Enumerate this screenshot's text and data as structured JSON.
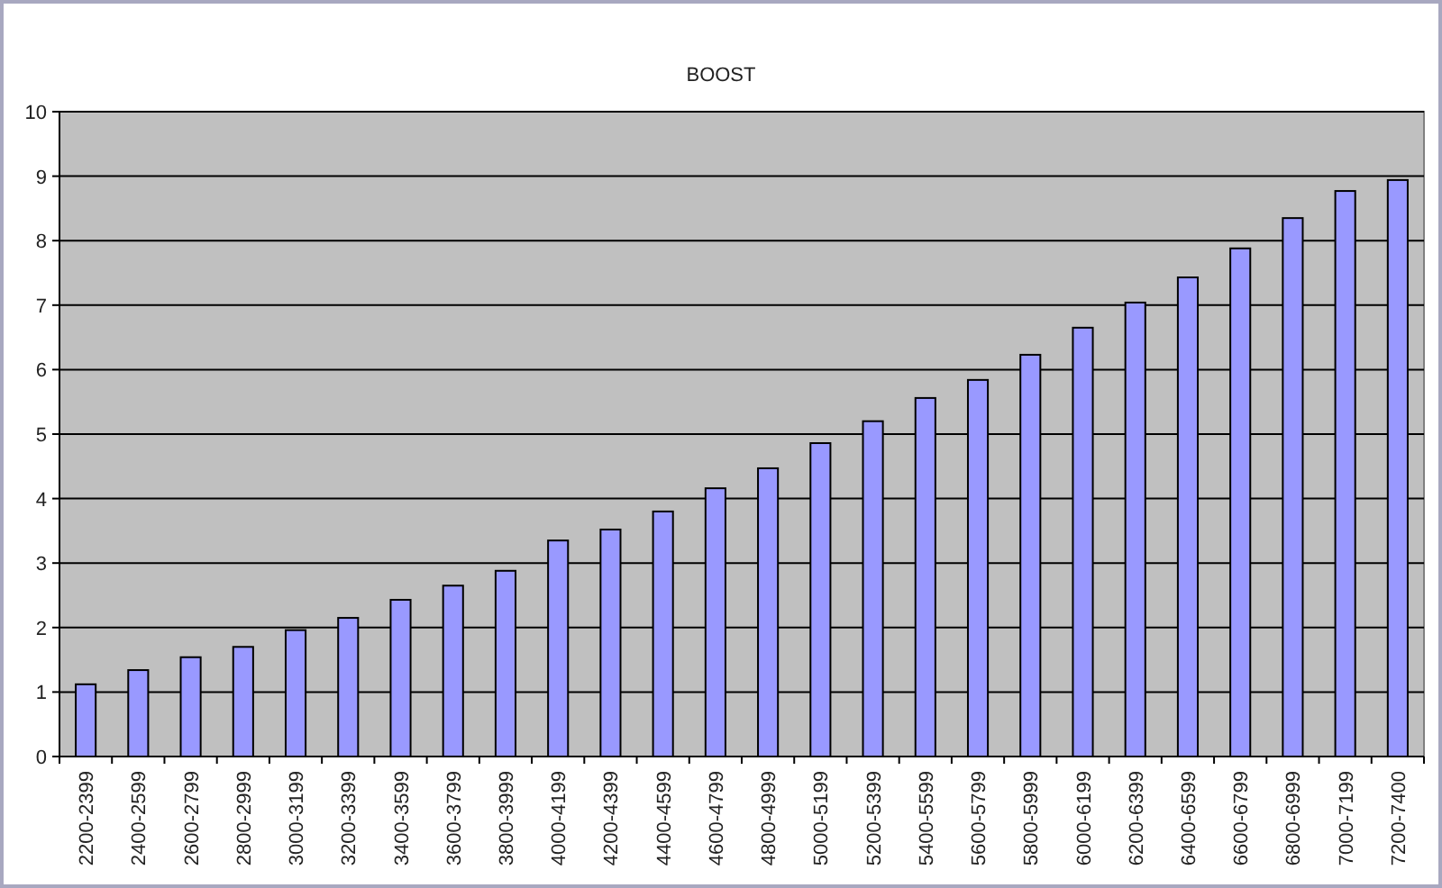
{
  "chart": {
    "chart_data": {
      "type": "bar",
      "title": "BOOST",
      "grid": true,
      "categories": [
        "2200-2399",
        "2400-2599",
        "2600-2799",
        "2800-2999",
        "3000-3199",
        "3200-3399",
        "3400-3599",
        "3600-3799",
        "3800-3999",
        "4000-4199",
        "4200-4399",
        "4400-4599",
        "4600-4799",
        "4800-4999",
        "5000-5199",
        "5200-5399",
        "5400-5599",
        "5600-5799",
        "5800-5999",
        "6000-6199",
        "6200-6399",
        "6400-6599",
        "6600-6799",
        "6800-6999",
        "7000-7199",
        "7200-7400"
      ],
      "values": [
        1.12,
        1.34,
        1.54,
        1.7,
        1.96,
        2.15,
        2.43,
        2.65,
        2.88,
        3.35,
        3.52,
        3.8,
        4.16,
        4.47,
        4.86,
        5.2,
        5.56,
        5.84,
        6.23,
        6.65,
        7.04,
        7.43,
        7.88,
        8.35,
        8.77,
        8.94
      ],
      "ylim": [
        0,
        10
      ],
      "yticks": [
        0,
        1,
        2,
        3,
        4,
        5,
        6,
        7,
        8,
        9,
        10
      ]
    }
  }
}
